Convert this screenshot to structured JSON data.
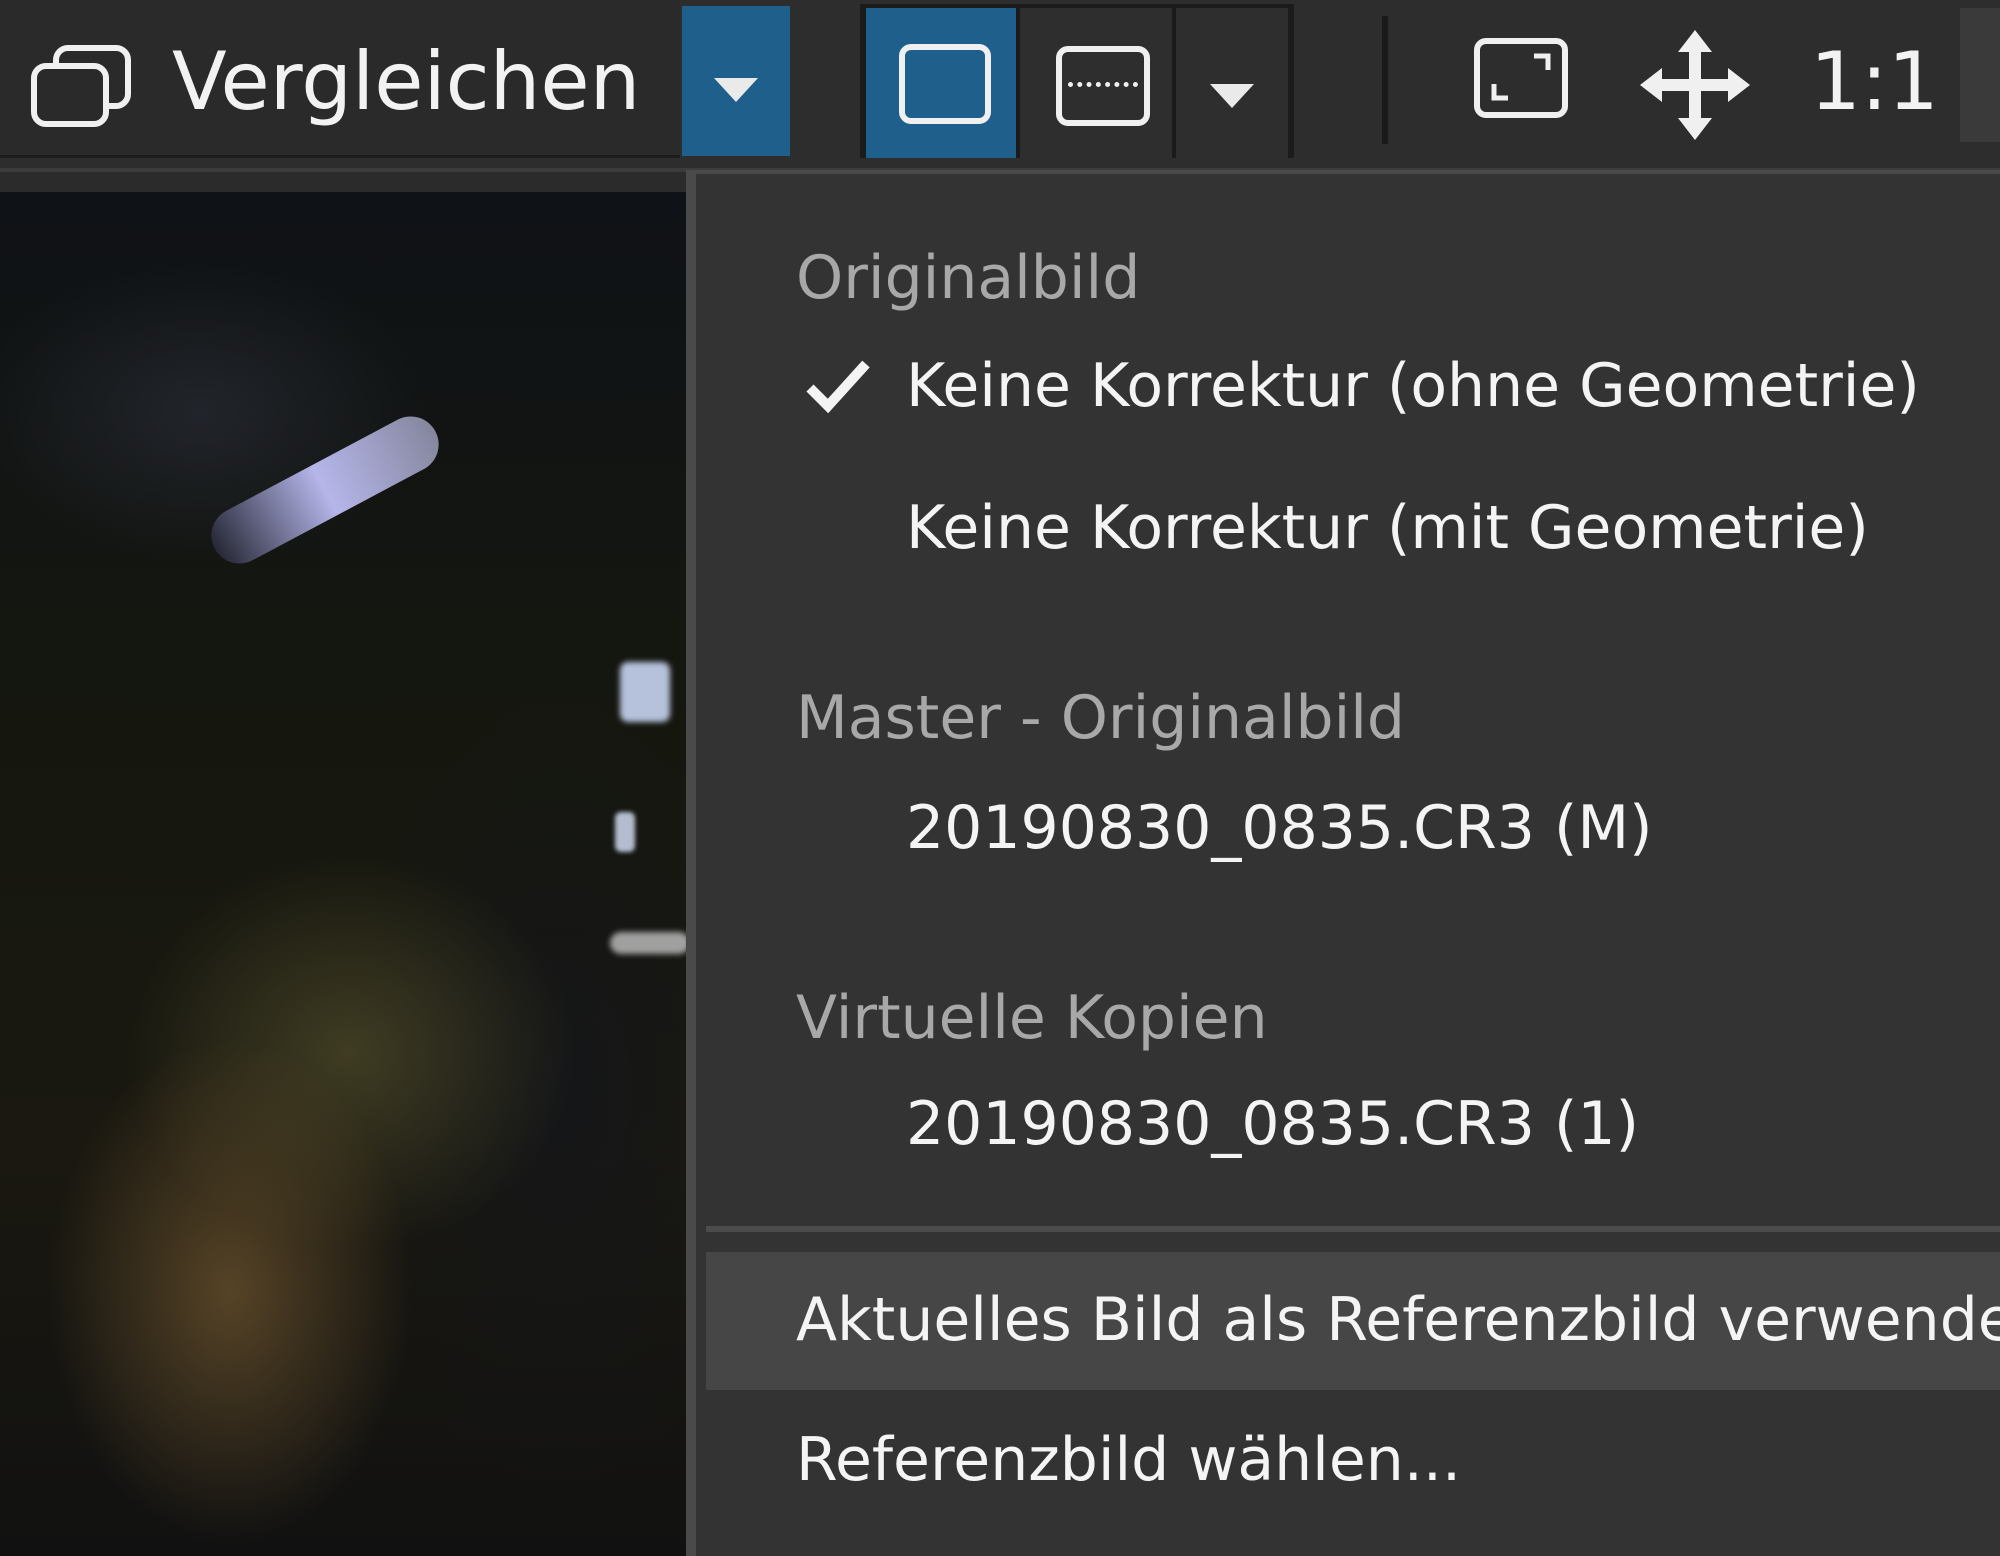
{
  "toolbar": {
    "compare_label": "Vergleichen",
    "zoom_label": "1:1"
  },
  "menu": {
    "sections": [
      {
        "header": "Originalbild",
        "items": [
          {
            "label": "Keine Korrektur (ohne Geometrie)",
            "checked": true
          },
          {
            "label": "Keine Korrektur (mit Geometrie)",
            "checked": false
          }
        ]
      },
      {
        "header": "Master - Originalbild",
        "items": [
          {
            "label": "20190830_0835.CR3 (M)",
            "checked": false
          }
        ]
      },
      {
        "header": "Virtuelle Kopien",
        "items": [
          {
            "label": "20190830_0835.CR3 (1)",
            "checked": false
          }
        ]
      }
    ],
    "actions": [
      {
        "label": "Aktuelles Bild als Referenzbild verwenden",
        "highlighted": true
      },
      {
        "label": "Referenzbild wählen...",
        "highlighted": false
      }
    ]
  },
  "colors": {
    "accent": "#1e5f8b",
    "menu_background": "#333333",
    "toolbar_background": "#2d2d2d"
  },
  "icons": {
    "compare": "compare-layers-icon",
    "single_view": "single-view-icon",
    "split_view": "split-view-icon",
    "fit": "fit-to-screen-icon",
    "move": "move-arrows-icon",
    "check": "check-icon"
  }
}
